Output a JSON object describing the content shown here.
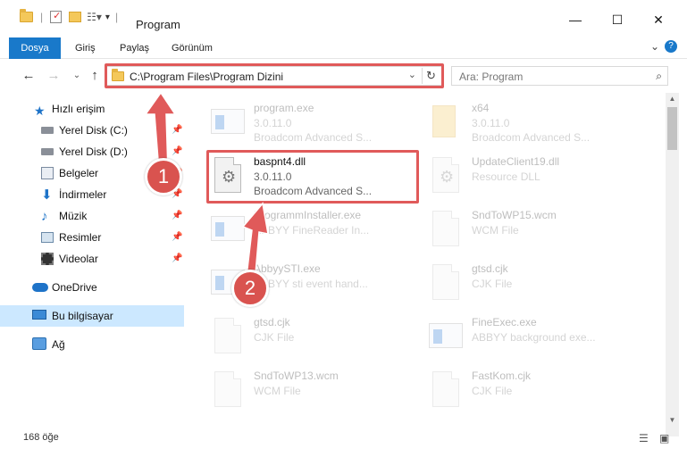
{
  "window": {
    "title": "Program",
    "minimize": "—",
    "maximize": "☐",
    "close": "✕"
  },
  "ribbon": {
    "tabs": [
      "Dosya",
      "Giriş",
      "Paylaş",
      "Görünüm"
    ],
    "expand": "⌄",
    "help": "?"
  },
  "address": {
    "path": "C:\\Program Files\\Program Dizini",
    "search_placeholder": "Ara: Program"
  },
  "sidebar": {
    "items": [
      {
        "label": "Hızlı erişim",
        "icon": "star-icon"
      },
      {
        "label": "Yerel Disk (C:)",
        "icon": "drive-icon"
      },
      {
        "label": "Yerel Disk (D:)",
        "icon": "drive-icon"
      },
      {
        "label": "Belgeler",
        "icon": "documents-icon"
      },
      {
        "label": "İndirmeler",
        "icon": "download-icon"
      },
      {
        "label": "Müzik",
        "icon": "music-icon"
      },
      {
        "label": "Resimler",
        "icon": "pictures-icon"
      },
      {
        "label": "Videolar",
        "icon": "videos-icon"
      },
      {
        "label": "OneDrive",
        "icon": "cloud-icon"
      },
      {
        "label": "Bu bilgisayar",
        "icon": "computer-icon"
      },
      {
        "label": "Ağ",
        "icon": "network-icon"
      }
    ]
  },
  "files": [
    {
      "name": "program.exe",
      "line2": "3.0.11.0",
      "line3": "Broadcom Advanced S..."
    },
    {
      "name": "x64",
      "line2": "3.0.11.0",
      "line3": "Broadcom Advanced S..."
    },
    {
      "name": "baspnt4.dll",
      "line2": "3.0.11.0",
      "line3": "Broadcom Advanced S..."
    },
    {
      "name": "UpdateClient19.dll",
      "line2": "Resource DLL",
      "line3": ""
    },
    {
      "name": "ProgrammInstaller.exe",
      "line2": "ABBYY FineReader In...",
      "line3": ""
    },
    {
      "name": "SndToWP15.wcm",
      "line2": "WCM File",
      "line3": ""
    },
    {
      "name": "AbbyySTI.exe",
      "line2": "ABBYY sti event hand...",
      "line3": ""
    },
    {
      "name": "gtsd.cjk",
      "line2": "CJK File",
      "line3": ""
    },
    {
      "name": "gtsd.cjk",
      "line2": "CJK File",
      "line3": ""
    },
    {
      "name": "FineExec.exe",
      "line2": "ABBYY background exe...",
      "line3": ""
    },
    {
      "name": "SndToWP13.wcm",
      "line2": "WCM File",
      "line3": ""
    },
    {
      "name": "FastKom.cjk",
      "line2": "CJK File",
      "line3": ""
    }
  ],
  "status": {
    "count": "168 öğe"
  },
  "annotations": {
    "badge1": "1",
    "badge2": "2"
  },
  "colors": {
    "accent": "#1979ca",
    "highlight": "#e05a5a",
    "selected": "#cce8ff"
  }
}
